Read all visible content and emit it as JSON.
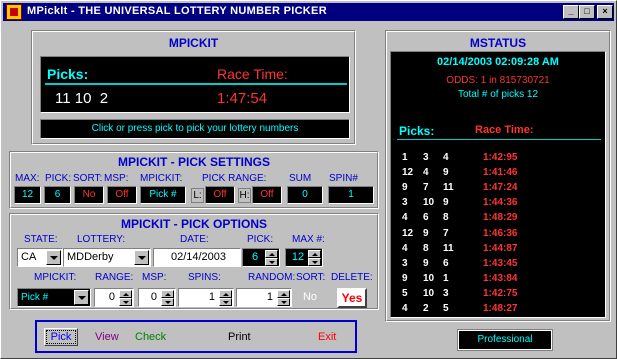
{
  "window": {
    "title": "MPickIt - THE UNIVERSAL LOTTERY NUMBER PICKER",
    "controls": [
      "_",
      "□",
      "×"
    ]
  },
  "mpickit": {
    "title": "MPICKIT",
    "picks_label": "Picks:",
    "race_time_label": "Race Time:",
    "picks_value": "11 10  2",
    "race_time_value": "1:47:54",
    "hint": "Click or press pick to pick your lottery numbers"
  },
  "settings": {
    "title": "MPICKIT -  PICK SETTINGS",
    "headers": {
      "max": "MAX:",
      "pick": "PICK:",
      "sort": "SORT:",
      "msp": "MSP:",
      "mpickit": "MPICKIT:",
      "pick_range": "PICK RANGE:",
      "sum": "SUM",
      "spin": "SPIN#"
    },
    "values": {
      "max": "12",
      "pick": "6",
      "sort": "No",
      "msp": "Off",
      "mpickit": "Pick #",
      "l_label": "L:",
      "l_value": "Off",
      "h_label": "H:",
      "h_value": "Off",
      "sum": "0",
      "spin": "1"
    }
  },
  "options": {
    "title": "MPICKIT - PICK OPTIONS",
    "headers": {
      "state": "STATE:",
      "lottery": "LOTTERY:",
      "date": "DATE:",
      "pick": "PICK:",
      "max": "MAX #:",
      "mpickit": "MPICKIT:",
      "range": "RANGE:",
      "msp": "MSP:",
      "spins": "SPINS:",
      "random": "RANDOM:",
      "sort": "SORT:",
      "delete": "DELETE:"
    },
    "values": {
      "state": "CA",
      "lottery": "MDDerby",
      "date": "02/14/2003",
      "pick": "6",
      "max": "12",
      "mpickit": "Pick #",
      "range": "0",
      "msp": "0",
      "spins": "1",
      "random": "1",
      "sort": "No",
      "delete": "Yes"
    }
  },
  "nav": {
    "pick": "Pick",
    "view": "View",
    "check": "Check",
    "print": "Print",
    "exit": "Exit"
  },
  "mstatus": {
    "title": "MSTATUS",
    "datetime": "02/14/2003 02:09:28 AM",
    "odds": "ODDS: 1 in 815730721",
    "total": "Total # of picks 12",
    "picks_label": "Picks:",
    "race_time_label": "Race Time:",
    "rows": [
      {
        "n1": "1",
        "n2": "3",
        "n3": "4",
        "time": "1:42:95"
      },
      {
        "n1": "12",
        "n2": "4",
        "n3": "9",
        "time": "1:41:46"
      },
      {
        "n1": "9",
        "n2": "7",
        "n3": "11",
        "time": "1:47:24"
      },
      {
        "n1": "3",
        "n2": "10",
        "n3": "9",
        "time": "1:44:36"
      },
      {
        "n1": "4",
        "n2": "6",
        "n3": "8",
        "time": "1:48:29"
      },
      {
        "n1": "12",
        "n2": "9",
        "n3": "7",
        "time": "1:46:36"
      },
      {
        "n1": "4",
        "n2": "8",
        "n3": "11",
        "time": "1:44:87"
      },
      {
        "n1": "3",
        "n2": "9",
        "n3": "6",
        "time": "1:43:45"
      },
      {
        "n1": "9",
        "n2": "10",
        "n3": "1",
        "time": "1:43:84"
      },
      {
        "n1": "5",
        "n2": "10",
        "n3": "3",
        "time": "1:42:75"
      },
      {
        "n1": "4",
        "n2": "2",
        "n3": "5",
        "time": "1:48:27"
      }
    ],
    "edition": "Professional"
  },
  "colors": {
    "title_bar": "#000080",
    "panel_bg": "#c0c0c0",
    "heading_blue": "#0000cc",
    "cyan": "#00ffff",
    "red": "#ff3333",
    "black": "#000000"
  }
}
